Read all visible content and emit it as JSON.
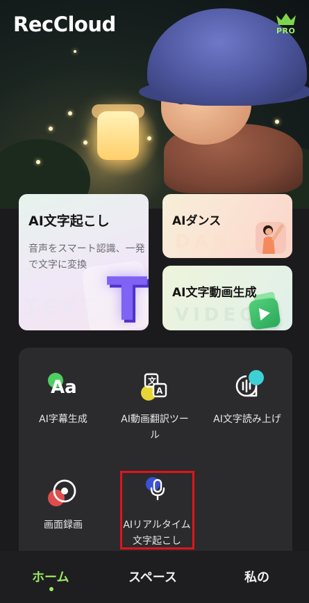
{
  "header": {
    "app_title": "RecCloud",
    "pro_badge": "PRO"
  },
  "feature_cards": {
    "text_card": {
      "title": "AI文字起こし",
      "subtitle": "音声をスマート認識、一発で文字に変換",
      "bg_word": "TEXT"
    },
    "dance_card": {
      "title": "AIダンス",
      "bg_word": "DANCE"
    },
    "video_card": {
      "title": "AI文字動画生成",
      "bg_word": "VIDEO"
    }
  },
  "tools": [
    {
      "label": "AI字幕生成",
      "icon": "subtitle-aa-icon"
    },
    {
      "label": "AI動画翻訳ツール",
      "icon": "video-translate-icon"
    },
    {
      "label": "AI文字読み上げ",
      "icon": "text-to-speech-icon"
    },
    {
      "label": "画面録画",
      "icon": "screen-record-icon"
    },
    {
      "label": "AIリアルタイム文字起こし",
      "icon": "microphone-icon"
    }
  ],
  "bottom_nav": {
    "items": [
      {
        "label": "ホーム",
        "active": true
      },
      {
        "label": "スペース",
        "active": false
      },
      {
        "label": "私の",
        "active": false
      }
    ]
  },
  "colors": {
    "background": "#1b1b1d",
    "panel": "#2b2b2e",
    "accent_green": "#9be865",
    "highlight_red": "#e1141a",
    "t_purple": "#7e63f4"
  }
}
